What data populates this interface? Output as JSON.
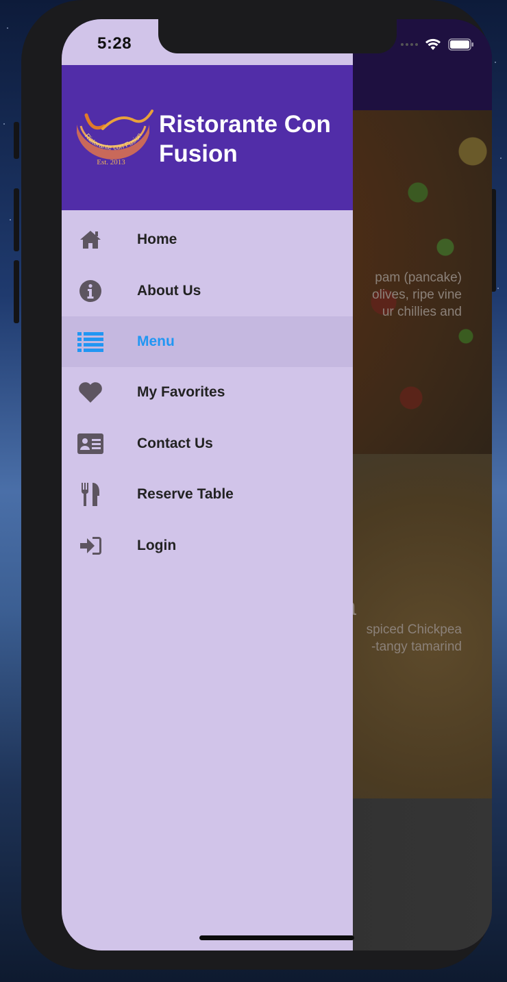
{
  "status_bar": {
    "time": "5:28"
  },
  "drawer": {
    "brand_title": "Ristorante Con Fusion",
    "logo_text": "Ristorante con Fusion",
    "logo_est": "Est. 2013",
    "active_color": "#2196f3",
    "header_color": "#512da8",
    "background_color": "#d1c4e9",
    "items": [
      {
        "label": "Home",
        "icon": "home-icon"
      },
      {
        "label": "About Us",
        "icon": "info-icon"
      },
      {
        "label": "Menu",
        "icon": "list-icon",
        "active": true
      },
      {
        "label": "My Favorites",
        "icon": "heart-icon"
      },
      {
        "label": "Contact Us",
        "icon": "address-card-icon"
      },
      {
        "label": "Reserve Table",
        "icon": "cutlery-icon"
      },
      {
        "label": "Login",
        "icon": "sign-in-icon"
      }
    ]
  },
  "background": {
    "card1_text": "pam (pancake)\nolives, ripe vine\nur chillies and",
    "card2_title": "a",
    "card2_text": "spiced Chickpea\n-tangy tamarind"
  }
}
